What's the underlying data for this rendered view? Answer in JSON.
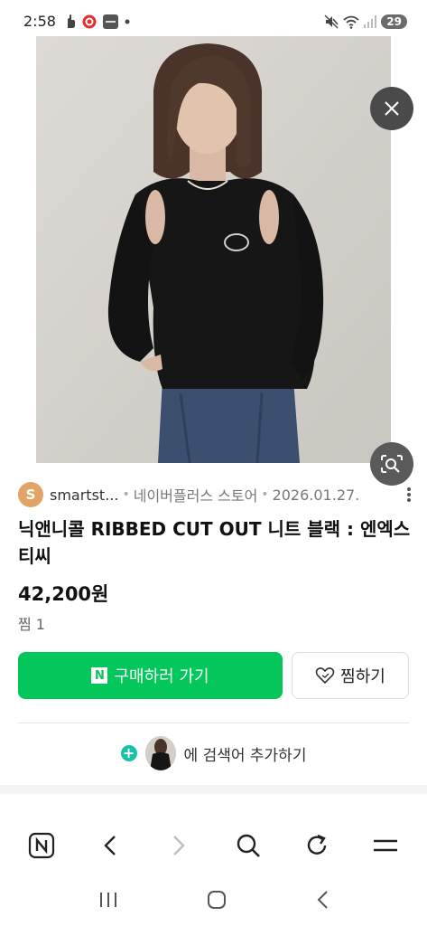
{
  "status": {
    "time": "2:58",
    "battery": "29"
  },
  "seller": {
    "avatar_letter": "S",
    "name": "smartst...",
    "store": "네이버플러스 스토어",
    "date": "2026.01.27."
  },
  "product": {
    "title": "닉앤니콜 RIBBED CUT OUT 니트 블랙 : 엔엑스티씨",
    "price": "42,200원",
    "jjim": "찜 1"
  },
  "actions": {
    "n_logo": "N",
    "buy_label": "구매하러 가기",
    "wish_label": "찜하기"
  },
  "add_search": {
    "label": "에 검색어 추가하기"
  },
  "colors": {
    "brand_green": "#03c75a",
    "teal_plus": "#19c2a6"
  }
}
